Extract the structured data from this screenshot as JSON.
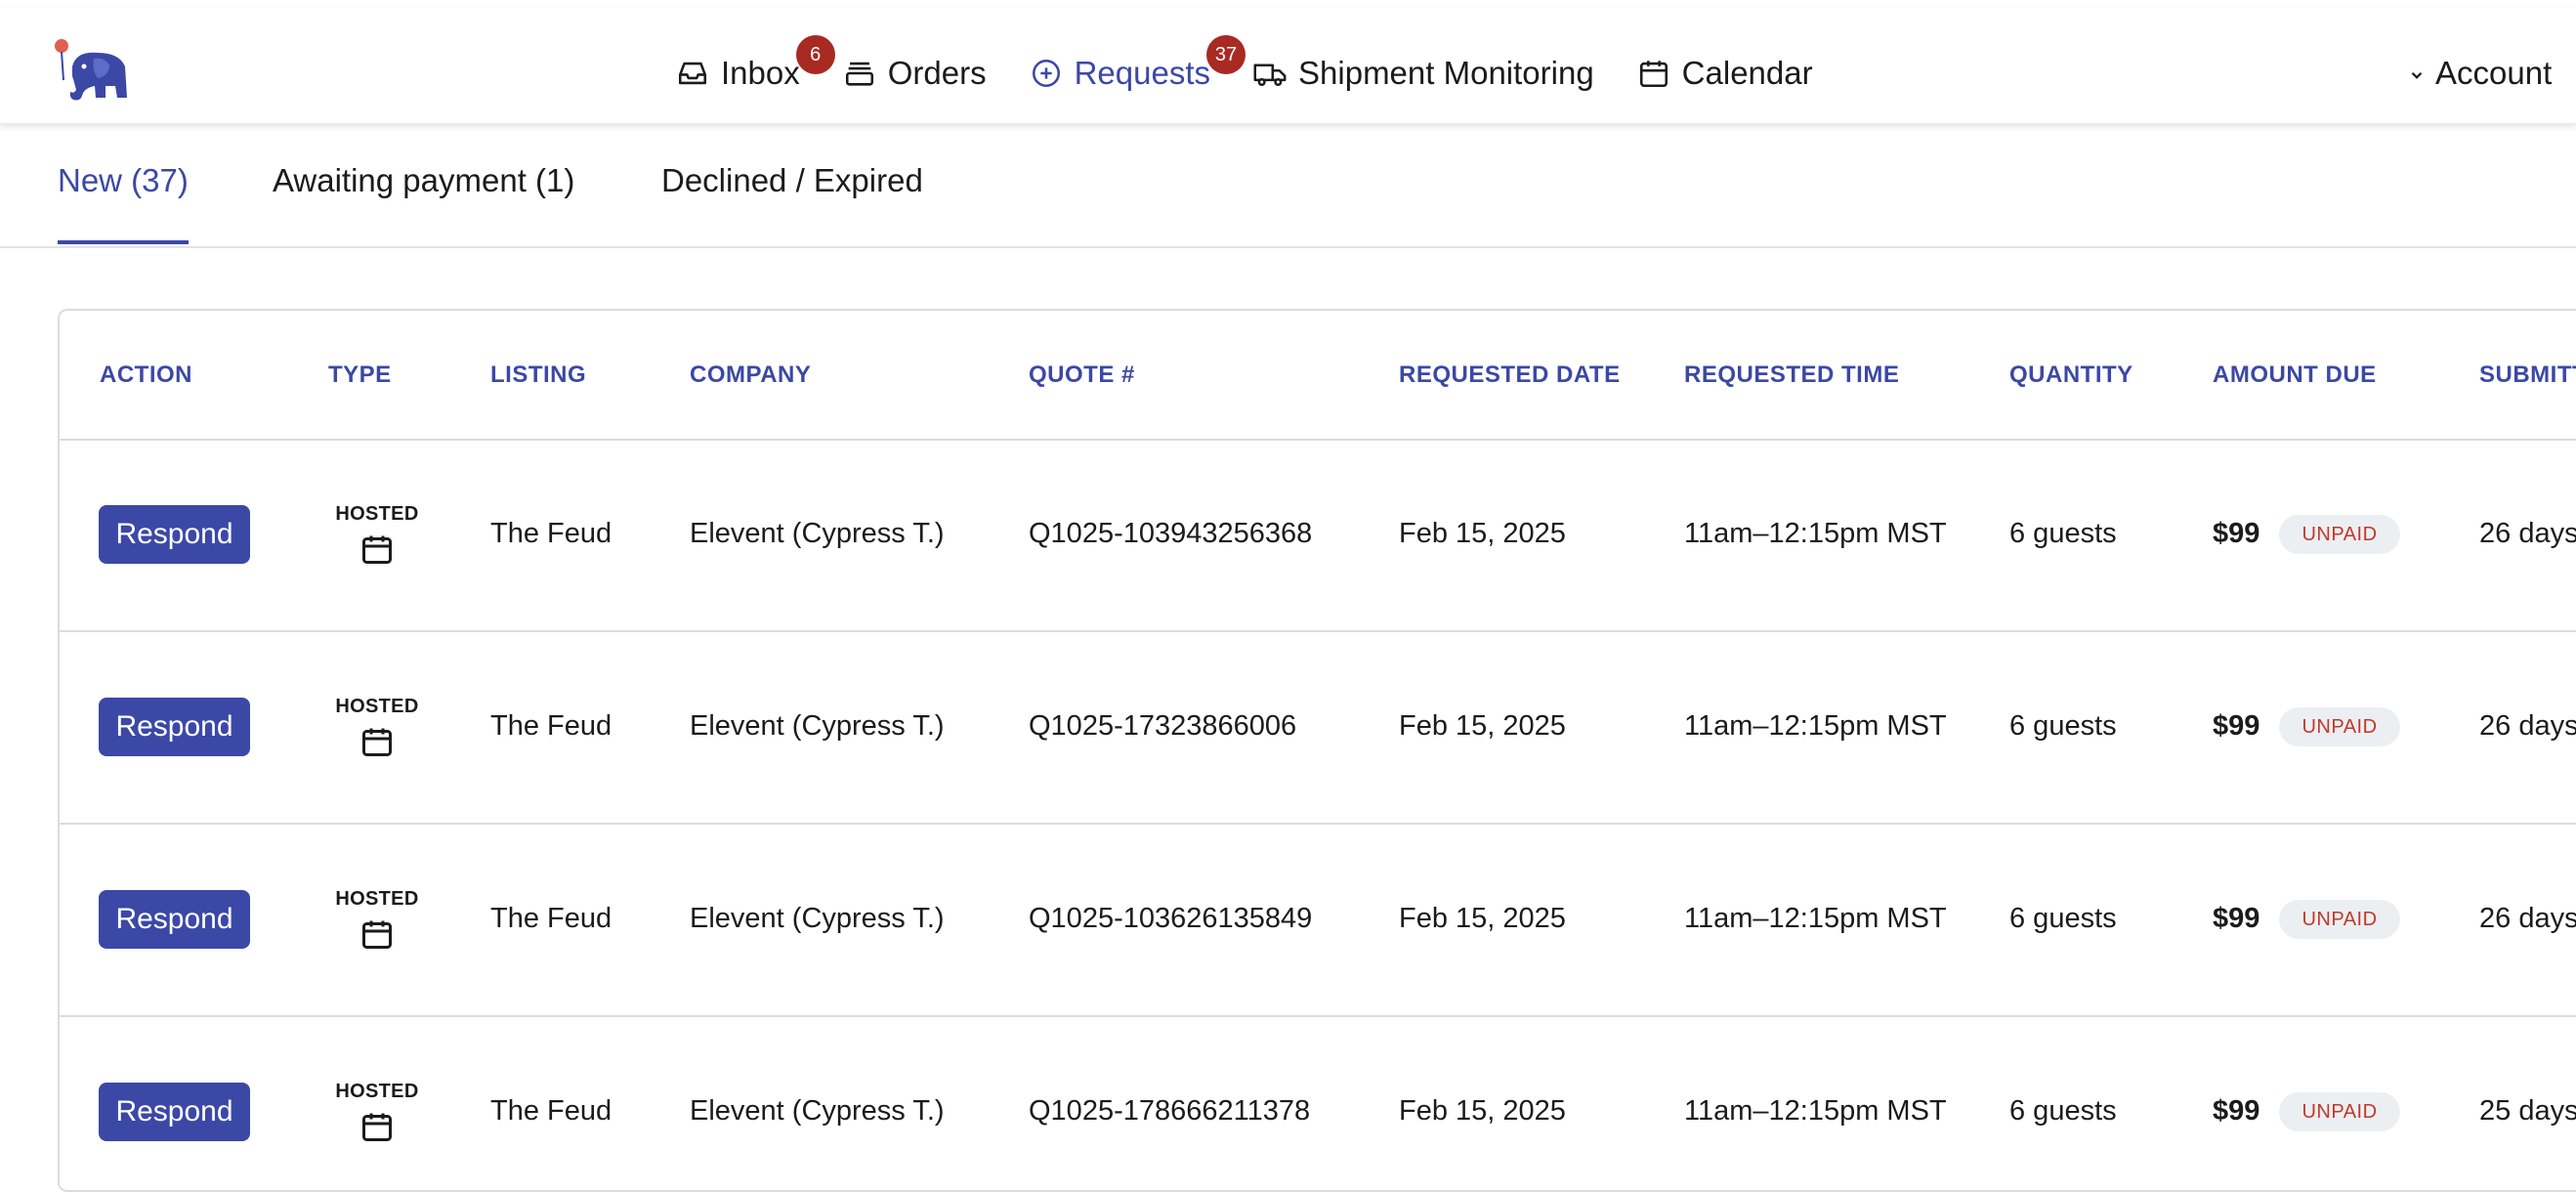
{
  "nav": {
    "items": [
      {
        "label": "Inbox",
        "icon": "inbox-icon",
        "badge": "6"
      },
      {
        "label": "Orders",
        "icon": "orders-icon",
        "badge": null
      },
      {
        "label": "Requests",
        "icon": "plus-circle-icon",
        "badge": "37",
        "active": true
      },
      {
        "label": "Shipment Monitoring",
        "icon": "truck-icon",
        "badge": null
      },
      {
        "label": "Calendar",
        "icon": "calendar-icon",
        "badge": null
      }
    ],
    "account_label": "Account"
  },
  "tabs": [
    {
      "label": "New (37)",
      "active": true
    },
    {
      "label": "Awaiting payment (1)",
      "active": false
    },
    {
      "label": "Declined / Expired",
      "active": false
    }
  ],
  "table": {
    "headers": {
      "action": "ACTION",
      "type": "TYPE",
      "listing": "LISTING",
      "company": "COMPANY",
      "quote": "QUOTE #",
      "requested_date": "REQUESTED DATE",
      "requested_time": "REQUESTED TIME",
      "quantity": "QUANTITY",
      "amount_due": "AMOUNT DUE",
      "submitted": "SUBMITT"
    },
    "rows": [
      {
        "action": "Respond",
        "type": "HOSTED",
        "listing": "The Feud",
        "company": "Elevent (Cypress T.)",
        "quote": "Q1025-103943256368",
        "requested_date": "Feb 15, 2025",
        "requested_time": "11am–12:15pm MST",
        "quantity": "6 guests",
        "amount": "$99",
        "status": "UNPAID",
        "submitted": "26 days"
      },
      {
        "action": "Respond",
        "type": "HOSTED",
        "listing": "The Feud",
        "company": "Elevent (Cypress T.)",
        "quote": "Q1025-17323866006",
        "requested_date": "Feb 15, 2025",
        "requested_time": "11am–12:15pm MST",
        "quantity": "6 guests",
        "amount": "$99",
        "status": "UNPAID",
        "submitted": "26 days"
      },
      {
        "action": "Respond",
        "type": "HOSTED",
        "listing": "The Feud",
        "company": "Elevent (Cypress T.)",
        "quote": "Q1025-103626135849",
        "requested_date": "Feb 15, 2025",
        "requested_time": "11am–12:15pm MST",
        "quantity": "6 guests",
        "amount": "$99",
        "status": "UNPAID",
        "submitted": "26 days"
      },
      {
        "action": "Respond",
        "type": "HOSTED",
        "listing": "The Feud",
        "company": "Elevent (Cypress T.)",
        "quote": "Q1025-178666211378",
        "requested_date": "Feb 15, 2025",
        "requested_time": "11am–12:15pm MST",
        "quantity": "6 guests",
        "amount": "$99",
        "status": "UNPAID",
        "submitted": "25 days"
      }
    ]
  },
  "colors": {
    "accent": "#3b48a6",
    "badge": "#a82a22",
    "unpaid_text": "#c0392b"
  }
}
